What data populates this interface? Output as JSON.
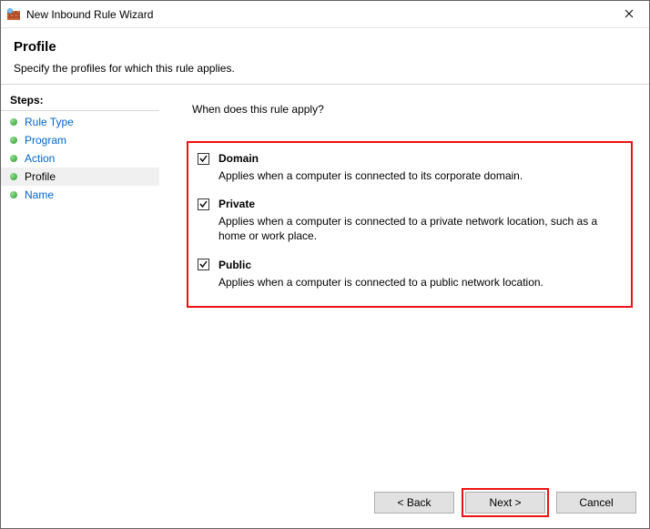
{
  "window": {
    "title": "New Inbound Rule Wizard"
  },
  "header": {
    "title": "Profile",
    "subtitle": "Specify the profiles for which this rule applies."
  },
  "sidebar": {
    "label": "Steps:",
    "items": [
      {
        "label": "Rule Type",
        "current": false
      },
      {
        "label": "Program",
        "current": false
      },
      {
        "label": "Action",
        "current": false
      },
      {
        "label": "Profile",
        "current": true
      },
      {
        "label": "Name",
        "current": false
      }
    ]
  },
  "content": {
    "prompt": "When does this rule apply?",
    "profiles": [
      {
        "key": "domain",
        "label": "Domain",
        "checked": true,
        "description": "Applies when a computer is connected to its corporate domain."
      },
      {
        "key": "private",
        "label": "Private",
        "checked": true,
        "description": "Applies when a computer is connected to a private network location, such as a home or work place."
      },
      {
        "key": "public",
        "label": "Public",
        "checked": true,
        "description": "Applies when a computer is connected to a public network location."
      }
    ]
  },
  "buttons": {
    "back": "< Back",
    "next": "Next >",
    "cancel": "Cancel"
  }
}
